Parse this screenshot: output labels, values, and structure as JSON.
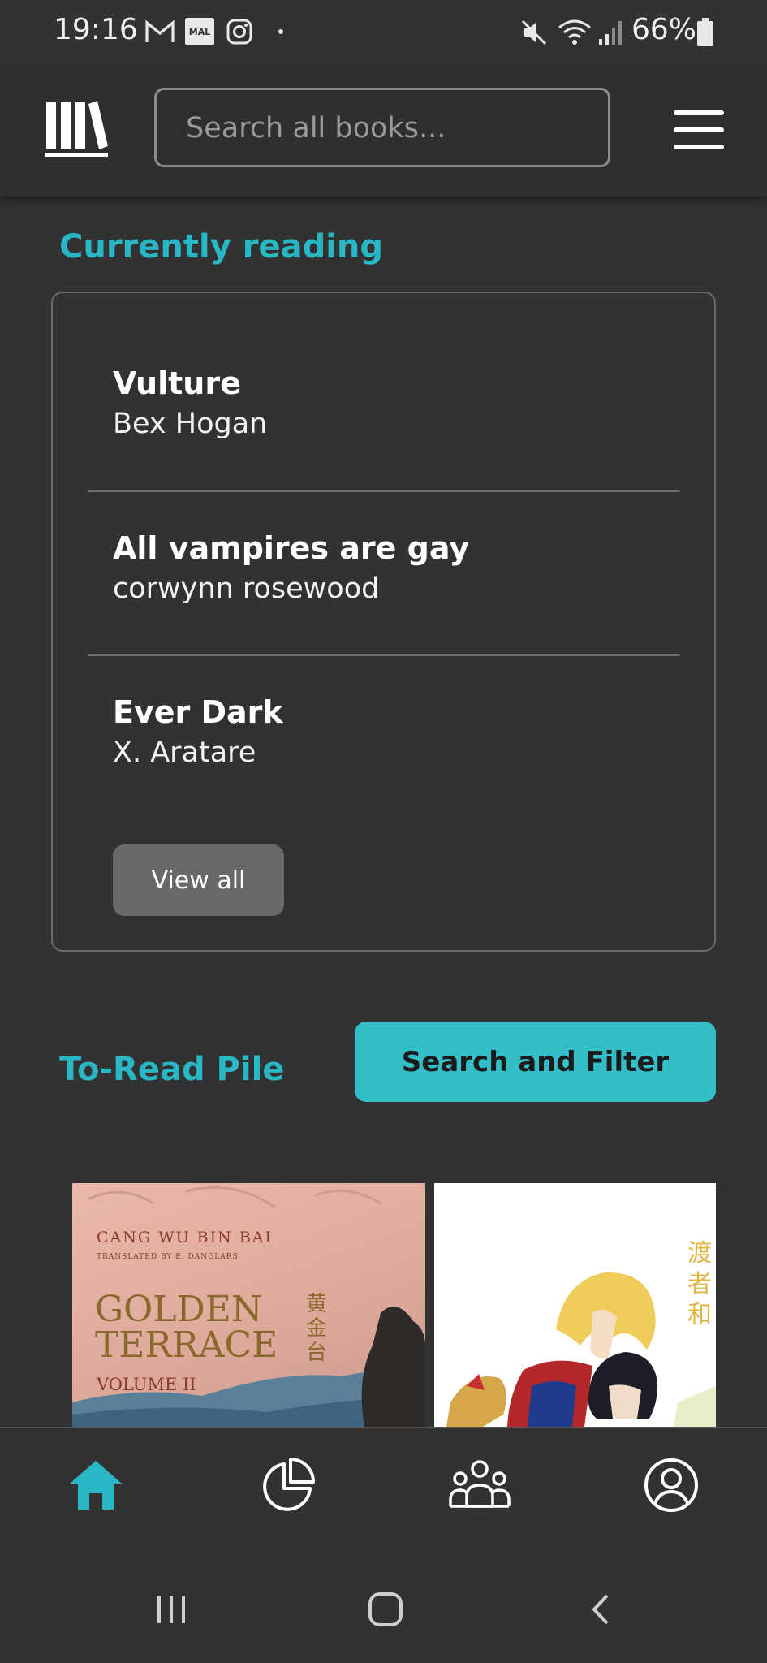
{
  "status_bar": {
    "time": "19:16",
    "battery": "66%",
    "notification_icons": [
      "gmail-icon",
      "mal-icon",
      "instagram-icon",
      "dot-icon"
    ],
    "system_icons": [
      "mute-icon",
      "wifi-icon",
      "signal-icon",
      "battery-icon"
    ],
    "mal_label": "MAL"
  },
  "header": {
    "search_placeholder": "Search all books...",
    "search_value": ""
  },
  "currently_reading": {
    "title": "Currently reading",
    "books": [
      {
        "title": "Vulture",
        "author": "Bex Hogan"
      },
      {
        "title": "All vampires are gay",
        "author": "corwynn rosewood"
      },
      {
        "title": "Ever Dark",
        "author": "X. Aratare"
      }
    ],
    "view_all_label": "View all"
  },
  "to_read": {
    "title": "To-Read Pile",
    "search_filter_label": "Search and Filter",
    "covers": [
      {
        "author": "CANG WU BIN BAI",
        "translator": "TRANSLATED BY E. DANGLARS",
        "title_line1": "GOLDEN",
        "title_line2": "TERRACE",
        "volume": "VOLUME II",
        "cjk": "黄金台"
      },
      {
        "cjk": "渡者和"
      }
    ]
  },
  "bottom_nav": {
    "items": [
      "home-icon",
      "stats-icon",
      "community-icon",
      "profile-icon"
    ],
    "active": "home-icon",
    "active_color": "#2ab7c5"
  },
  "system_nav": [
    "recents-button",
    "home-button",
    "back-button"
  ],
  "colors": {
    "accent": "#2ab7c5",
    "button_accent": "#33bec8",
    "background": "#323232"
  }
}
